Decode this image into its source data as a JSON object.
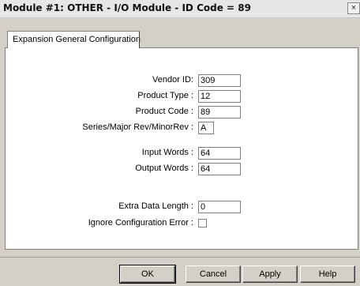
{
  "window": {
    "title": "Module #1: OTHER - I/O Module - ID Code = 89",
    "close_symbol": "×"
  },
  "tab": {
    "label": "Expansion General Configuration"
  },
  "form": {
    "vendor_id": {
      "label": "Vendor ID:",
      "value": "309"
    },
    "product_type": {
      "label": "Product Type :",
      "value": "12"
    },
    "product_code": {
      "label": "Product Code :",
      "value": "89"
    },
    "series_rev": {
      "label": "Series/Major Rev/MinorRev :",
      "value": "A"
    },
    "input_words": {
      "label": "Input Words :",
      "value": "64"
    },
    "output_words": {
      "label": "Output Words :",
      "value": "64"
    },
    "extra_data_length": {
      "label": "Extra Data Length :",
      "value": "0"
    },
    "ignore_config_error": {
      "label": "Ignore Configuration Error :",
      "checked": false
    }
  },
  "buttons": {
    "ok": "OK",
    "cancel": "Cancel",
    "apply": "Apply",
    "help": "Help"
  }
}
